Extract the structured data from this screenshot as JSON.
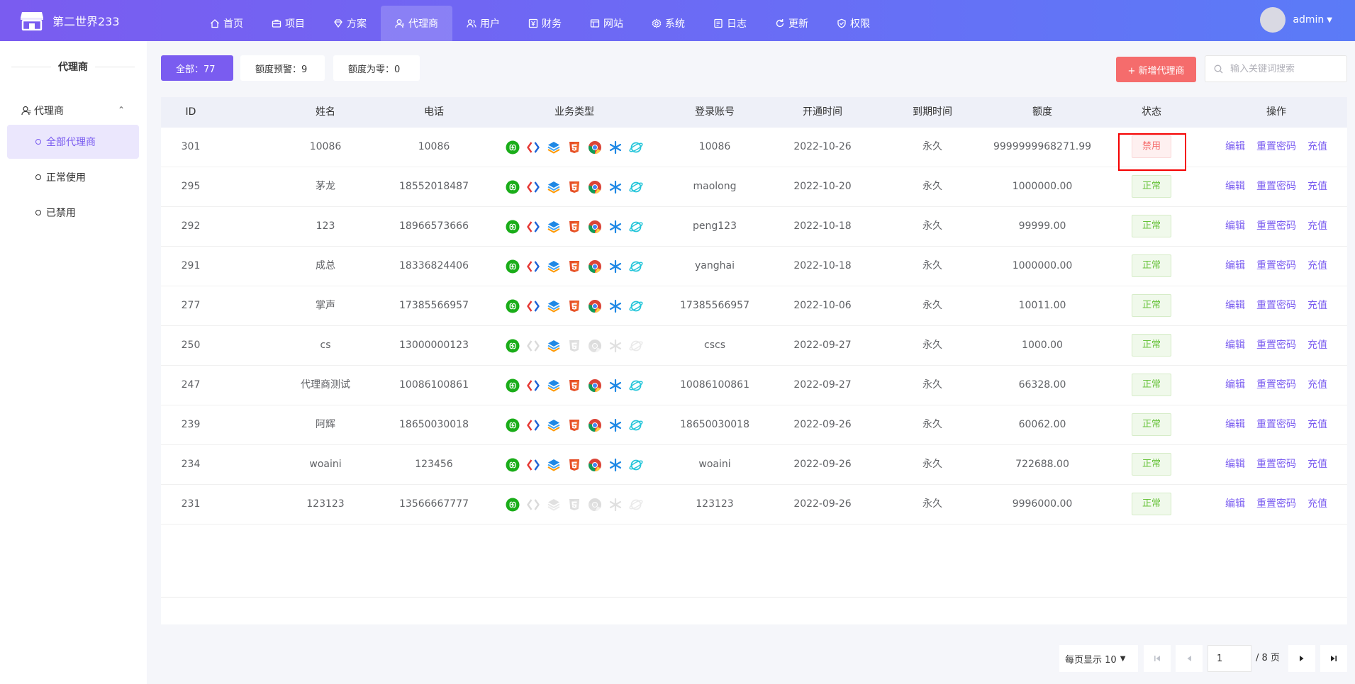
{
  "app": {
    "title": "第二世界233"
  },
  "nav": [
    {
      "label": "首页",
      "icon": "home-icon"
    },
    {
      "label": "项目",
      "icon": "briefcase-icon"
    },
    {
      "label": "方案",
      "icon": "diamond-icon"
    },
    {
      "label": "代理商",
      "icon": "user-icon",
      "active": true
    },
    {
      "label": "用户",
      "icon": "users-icon"
    },
    {
      "label": "财务",
      "icon": "finance-icon"
    },
    {
      "label": "网站",
      "icon": "browser-icon"
    },
    {
      "label": "系统",
      "icon": "gear-icon"
    },
    {
      "label": "日志",
      "icon": "document-icon"
    },
    {
      "label": "更新",
      "icon": "refresh-icon"
    },
    {
      "label": "权限",
      "icon": "shield-check-icon"
    }
  ],
  "user": {
    "name": "admin"
  },
  "sidebar": {
    "title": "代理商",
    "group": "代理商",
    "items": [
      {
        "label": "全部代理商",
        "active": true
      },
      {
        "label": "正常使用"
      },
      {
        "label": "已禁用"
      }
    ]
  },
  "filters": [
    {
      "label": "全部：77",
      "active": true
    },
    {
      "label": "额度预警：9"
    },
    {
      "label": "额度为零：0"
    }
  ],
  "toolbar": {
    "add_label": "+ 新增代理商",
    "search_placeholder": "输入关键词搜索"
  },
  "table": {
    "columns": [
      "ID",
      "姓名",
      "电话",
      "业务类型",
      "登录账号",
      "开通时间",
      "到期时间",
      "额度",
      "状态",
      "操作"
    ],
    "business_icons": [
      "mini-program-icon",
      "code-bracket-icon",
      "layers-icon",
      "html5-icon",
      "chrome-icon",
      "asterisk-icon",
      "planet-icon"
    ],
    "actions": [
      "编辑",
      "重置密码",
      "充值"
    ],
    "rows": [
      {
        "id": "301",
        "name": "10086",
        "phone": "10086",
        "biz": [
          1,
          1,
          1,
          1,
          1,
          1,
          1
        ],
        "account": "10086",
        "open": "2022-10-26",
        "expire": "永久",
        "quota": "9999999968271.99",
        "status": "禁用",
        "enabled": false
      },
      {
        "id": "295",
        "name": "茅龙",
        "phone": "18552018487",
        "biz": [
          1,
          1,
          1,
          1,
          1,
          1,
          1
        ],
        "account": "maolong",
        "open": "2022-10-20",
        "expire": "永久",
        "quota": "1000000.00",
        "status": "正常",
        "enabled": true
      },
      {
        "id": "292",
        "name": "123",
        "phone": "18966573666",
        "biz": [
          1,
          1,
          1,
          1,
          1,
          1,
          1
        ],
        "account": "peng123",
        "open": "2022-10-18",
        "expire": "永久",
        "quota": "99999.00",
        "status": "正常",
        "enabled": true
      },
      {
        "id": "291",
        "name": "成总",
        "phone": "18336824406",
        "biz": [
          1,
          1,
          1,
          1,
          1,
          1,
          1
        ],
        "account": "yanghai",
        "open": "2022-10-18",
        "expire": "永久",
        "quota": "1000000.00",
        "status": "正常",
        "enabled": true
      },
      {
        "id": "277",
        "name": "掌声",
        "phone": "17385566957",
        "biz": [
          1,
          1,
          1,
          1,
          1,
          1,
          1
        ],
        "account": "17385566957",
        "open": "2022-10-06",
        "expire": "永久",
        "quota": "10011.00",
        "status": "正常",
        "enabled": true
      },
      {
        "id": "250",
        "name": "cs",
        "phone": "13000000123",
        "biz": [
          1,
          0,
          1,
          0,
          0,
          0,
          0
        ],
        "account": "cscs",
        "open": "2022-09-27",
        "expire": "永久",
        "quota": "1000.00",
        "status": "正常",
        "enabled": true
      },
      {
        "id": "247",
        "name": "代理商测试",
        "phone": "10086100861",
        "biz": [
          1,
          1,
          1,
          1,
          1,
          1,
          1
        ],
        "account": "10086100861",
        "open": "2022-09-27",
        "expire": "永久",
        "quota": "66328.00",
        "status": "正常",
        "enabled": true
      },
      {
        "id": "239",
        "name": "阿辉",
        "phone": "18650030018",
        "biz": [
          1,
          1,
          1,
          1,
          1,
          1,
          1
        ],
        "account": "18650030018",
        "open": "2022-09-26",
        "expire": "永久",
        "quota": "60062.00",
        "status": "正常",
        "enabled": true
      },
      {
        "id": "234",
        "name": "woaini",
        "phone": "123456",
        "biz": [
          1,
          1,
          1,
          1,
          1,
          1,
          1
        ],
        "account": "woaini",
        "open": "2022-09-26",
        "expire": "永久",
        "quota": "722688.00",
        "status": "正常",
        "enabled": true
      },
      {
        "id": "231",
        "name": "123123",
        "phone": "13566667777",
        "biz": [
          1,
          0,
          0,
          0,
          0,
          0,
          0
        ],
        "account": "123123",
        "open": "2022-09-26",
        "expire": "永久",
        "quota": "9996000.00",
        "status": "正常",
        "enabled": true
      }
    ]
  },
  "pagination": {
    "per_page_label": "每页显示 10",
    "current_page": "1",
    "total_label": "/ 8 页"
  },
  "colors": {
    "accent": "#7a5cf0",
    "danger": "#f56c6c",
    "success": "#67c23a"
  }
}
